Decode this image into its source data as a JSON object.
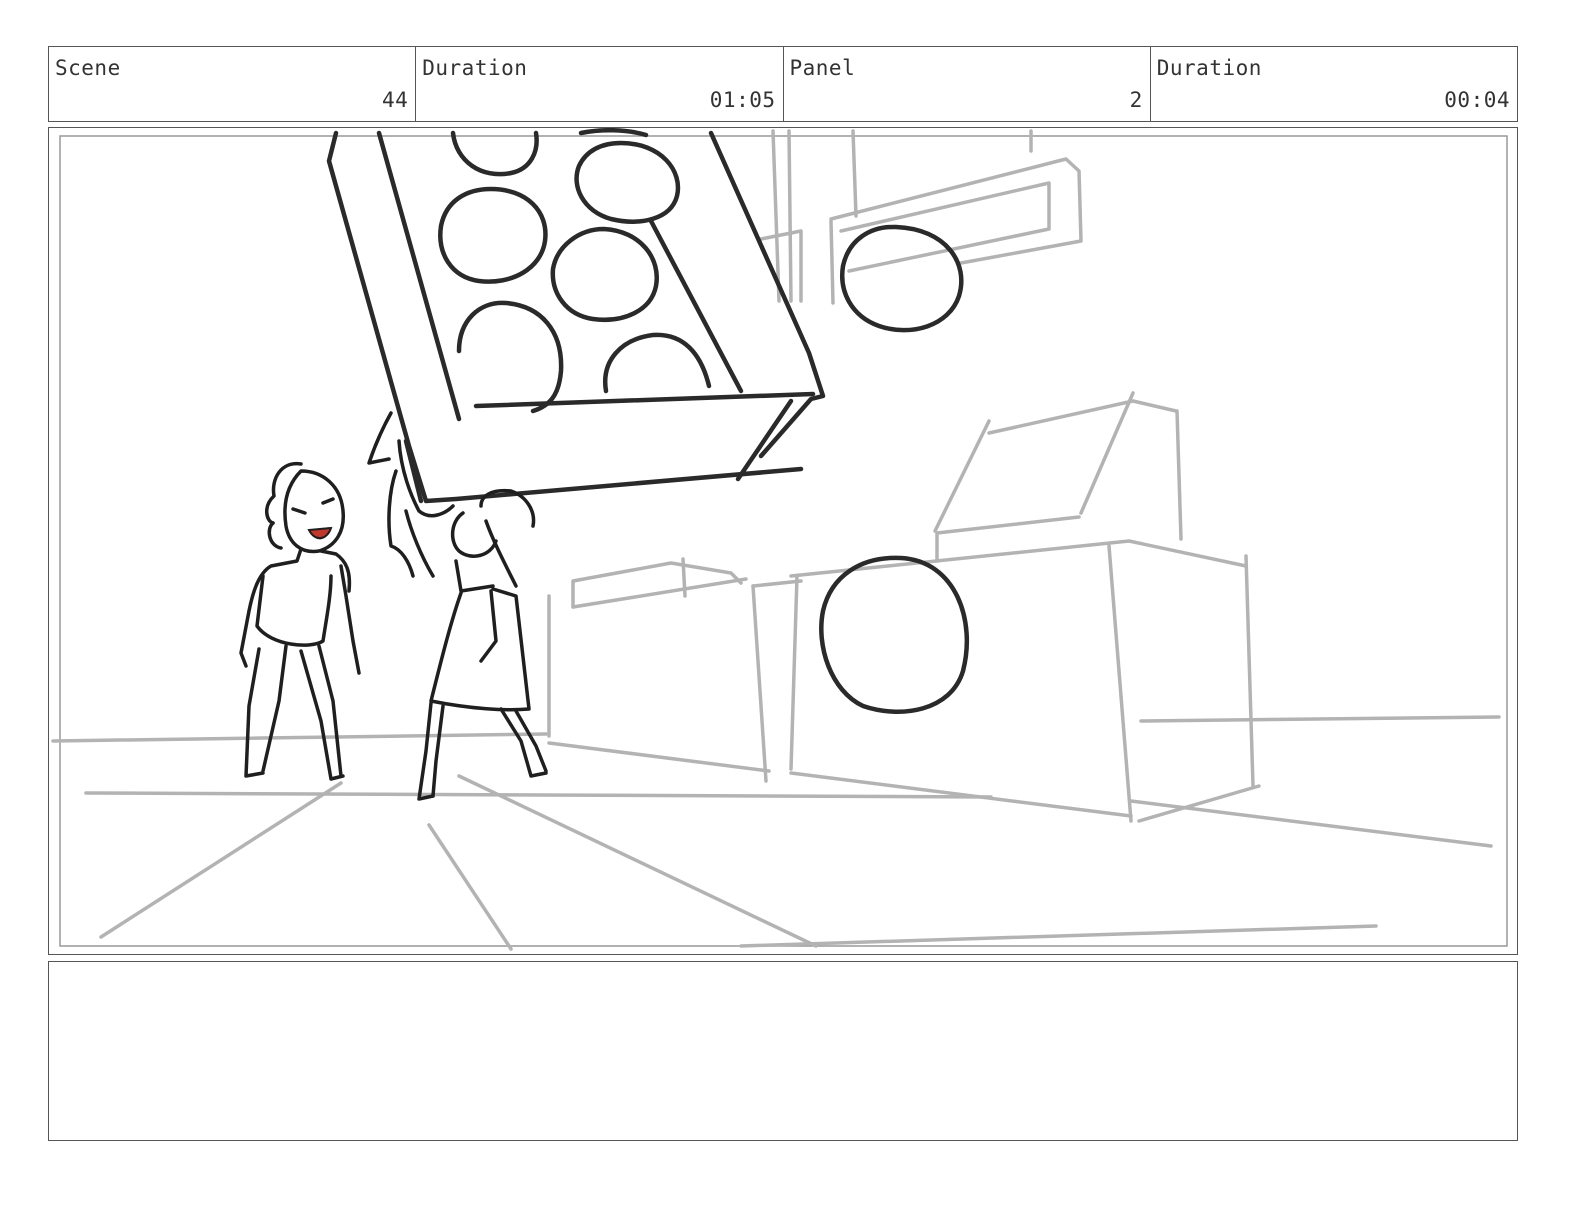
{
  "header": {
    "scene": {
      "label": "Scene",
      "value": "44"
    },
    "scene_duration": {
      "label": "Duration",
      "value": "01:05"
    },
    "panel": {
      "label": "Panel",
      "value": "2"
    },
    "panel_duration": {
      "label": "Duration",
      "value": "00:04"
    }
  },
  "notes": {
    "text": ""
  },
  "colors": {
    "ink": "#222222",
    "construction": "#b3b3b3",
    "blush": "#c0392b"
  }
}
